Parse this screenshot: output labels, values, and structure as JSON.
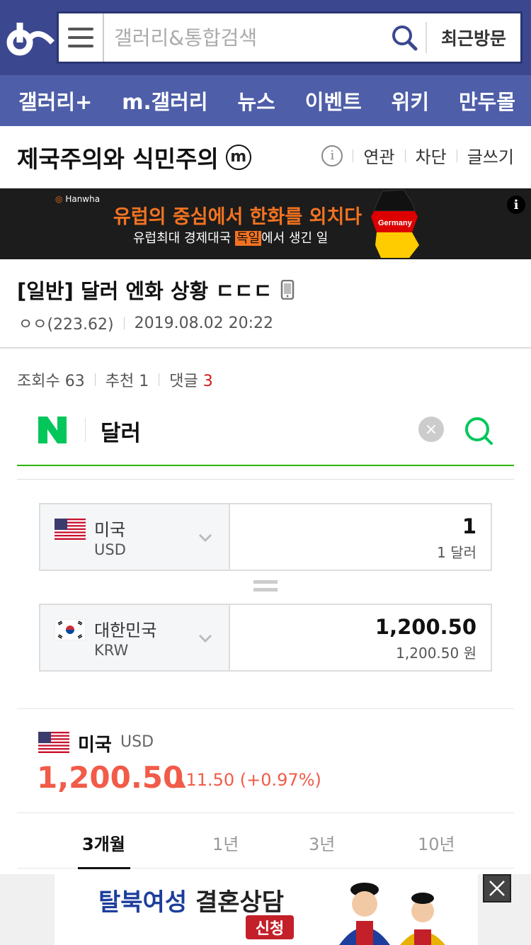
{
  "header": {
    "search_placeholder": "갤러리&통합검색",
    "recent_label": "최근방문"
  },
  "nav": {
    "items": [
      "갤러리+",
      "m.갤러리",
      "뉴스",
      "이벤트",
      "위키",
      "만두몰"
    ]
  },
  "gallery": {
    "title": "제국주의와 식민주의",
    "badge": "m",
    "actions": [
      "연관",
      "차단",
      "글쓰기"
    ]
  },
  "top_ad": {
    "brand": "Hanwha",
    "headline": "유럽의 중심에서 한화를 외치다",
    "sub_before": "유럽최대 경제대국 ",
    "sub_highlight": "독일",
    "sub_after": "에서 생긴 일",
    "map_label": "Germany",
    "info": "i"
  },
  "post": {
    "title": "[일반] 달러 엔화 상황 ㄷㄷㄷ",
    "author": "ㅇㅇ(223.62)",
    "date": "2019.08.02 20:22",
    "stats": {
      "views_label": "조회수 63",
      "recommend_label": "추천 1",
      "comments_label": "댓글",
      "comments_count": "3"
    }
  },
  "naver_search": {
    "query": "달러",
    "clear": "×"
  },
  "converter": {
    "from": {
      "name": "미국",
      "code": "USD",
      "amount": "1",
      "amount_words": "1 달러"
    },
    "to": {
      "name": "대한민국",
      "code": "KRW",
      "amount": "1,200.50",
      "amount_words": "1,200.50 원"
    }
  },
  "rate": {
    "country": "미국",
    "code": "USD",
    "value": "1,200.50",
    "change": "▲11.50 (+0.97%)",
    "accent_color": "#f15b48"
  },
  "period_tabs": [
    "3개월",
    "1년",
    "3년",
    "10년"
  ],
  "bottom_ad": {
    "title_part1": "탈북여성",
    "title_part2": " 결혼상담",
    "button": "신청"
  }
}
